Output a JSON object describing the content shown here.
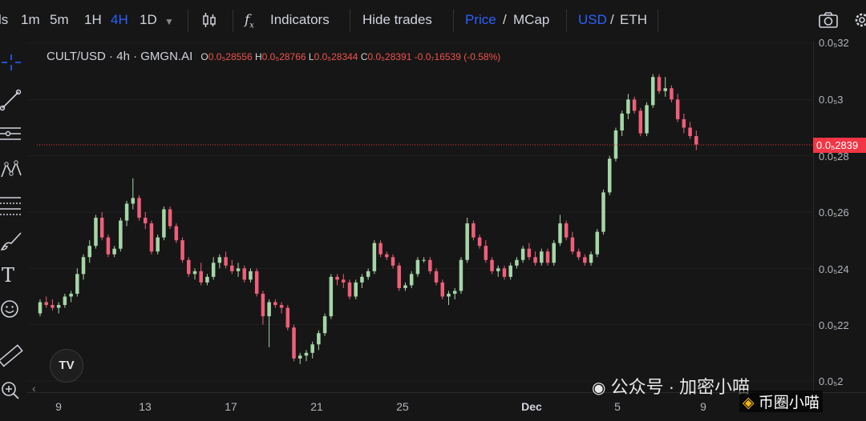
{
  "toolbar": {
    "intervals": [
      "ls",
      "1m",
      "5m",
      "1H",
      "4H",
      "1D"
    ],
    "active_interval": "4H",
    "indicators_label": "Indicators",
    "hide_trades_label": "Hide trades",
    "price_label": "Price",
    "mcap_label": "MCap",
    "usd_label": "USD",
    "eth_label": "ETH",
    "slash": "/"
  },
  "legend": {
    "symbol": "CULT/USD · 4h · GMGN.AI",
    "o_key": "O",
    "o_val": "0.0₅28556",
    "h_key": "H",
    "h_val": "0.0₅28766",
    "l_key": "L",
    "l_val": "0.0₅28344",
    "c_key": "C",
    "c_val": "0.0₅28391",
    "change": "-0.0₇16539 (-0.58%)"
  },
  "price_scale": {
    "labels": [
      "0.0₅32",
      "0.0₅3",
      "0.0₅28",
      "0.0₅26",
      "0.0₅24",
      "0.0₅22",
      "0.0₅2"
    ],
    "last_price": "0.0₅2839"
  },
  "time_scale": {
    "labels": [
      "9",
      "13",
      "17",
      "21",
      "25",
      "Dec",
      "5",
      "9"
    ]
  },
  "watermark": {
    "line1": "公众号 · 加密小喵",
    "line2": "币圈小喵"
  },
  "tv_logo_text": "TV",
  "colors": {
    "up": "#a5d6a7",
    "down": "#ef5f7a",
    "accent": "#2962ff",
    "last": "#f23645"
  },
  "chart_data": {
    "type": "candlestick",
    "x_labels": [
      "9",
      "13",
      "17",
      "21",
      "25",
      "Dec",
      "5",
      "9"
    ],
    "ylim": [
      1.98e-05,
      3.24e-05
    ],
    "last_price": 2.8391e-06,
    "candles": [
      [
        2.24,
        2.29,
        2.23,
        2.28
      ],
      [
        2.28,
        2.3,
        2.26,
        2.27
      ],
      [
        2.27,
        2.29,
        2.25,
        2.26
      ],
      [
        2.26,
        2.28,
        2.24,
        2.27
      ],
      [
        2.27,
        2.31,
        2.26,
        2.3
      ],
      [
        2.3,
        2.32,
        2.28,
        2.31
      ],
      [
        2.31,
        2.4,
        2.3,
        2.38
      ],
      [
        2.38,
        2.45,
        2.36,
        2.44
      ],
      [
        2.44,
        2.5,
        2.42,
        2.48
      ],
      [
        2.48,
        2.59,
        2.47,
        2.58
      ],
      [
        2.58,
        2.6,
        2.5,
        2.51
      ],
      [
        2.51,
        2.52,
        2.44,
        2.45
      ],
      [
        2.45,
        2.48,
        2.44,
        2.47
      ],
      [
        2.47,
        2.58,
        2.46,
        2.57
      ],
      [
        2.57,
        2.64,
        2.55,
        2.63
      ],
      [
        2.63,
        2.72,
        2.61,
        2.65
      ],
      [
        2.65,
        2.66,
        2.57,
        2.58
      ],
      [
        2.58,
        2.6,
        2.54,
        2.56
      ],
      [
        2.56,
        2.57,
        2.45,
        2.46
      ],
      [
        2.46,
        2.52,
        2.45,
        2.51
      ],
      [
        2.51,
        2.62,
        2.5,
        2.61
      ],
      [
        2.61,
        2.62,
        2.54,
        2.55
      ],
      [
        2.55,
        2.56,
        2.49,
        2.5
      ],
      [
        2.5,
        2.51,
        2.42,
        2.43
      ],
      [
        2.43,
        2.44,
        2.37,
        2.38
      ],
      [
        2.38,
        2.4,
        2.36,
        2.39
      ],
      [
        2.39,
        2.42,
        2.34,
        2.35
      ],
      [
        2.35,
        2.38,
        2.34,
        2.37
      ],
      [
        2.37,
        2.44,
        2.36,
        2.42
      ],
      [
        2.42,
        2.45,
        2.4,
        2.44
      ],
      [
        2.44,
        2.46,
        2.4,
        2.41
      ],
      [
        2.41,
        2.43,
        2.38,
        2.39
      ],
      [
        2.39,
        2.42,
        2.37,
        2.4
      ],
      [
        2.4,
        2.41,
        2.35,
        2.36
      ],
      [
        2.36,
        2.4,
        2.35,
        2.39
      ],
      [
        2.39,
        2.4,
        2.3,
        2.31
      ],
      [
        2.31,
        2.32,
        2.2,
        2.23
      ],
      [
        2.23,
        2.29,
        2.12,
        2.28
      ],
      [
        2.28,
        2.29,
        2.26,
        2.27
      ],
      [
        2.27,
        2.28,
        2.24,
        2.26
      ],
      [
        2.26,
        2.27,
        2.18,
        2.19
      ],
      [
        2.19,
        2.2,
        2.07,
        2.08
      ],
      [
        2.08,
        2.1,
        2.06,
        2.09
      ],
      [
        2.09,
        2.11,
        2.07,
        2.1
      ],
      [
        2.1,
        2.14,
        2.08,
        2.13
      ],
      [
        2.13,
        2.18,
        2.11,
        2.17
      ],
      [
        2.17,
        2.24,
        2.16,
        2.23
      ],
      [
        2.23,
        2.38,
        2.22,
        2.37
      ],
      [
        2.37,
        2.38,
        2.34,
        2.36
      ],
      [
        2.36,
        2.38,
        2.33,
        2.35
      ],
      [
        2.35,
        2.36,
        2.29,
        2.3
      ],
      [
        2.3,
        2.36,
        2.29,
        2.35
      ],
      [
        2.35,
        2.38,
        2.33,
        2.37
      ],
      [
        2.37,
        2.4,
        2.36,
        2.39
      ],
      [
        2.39,
        2.5,
        2.38,
        2.49
      ],
      [
        2.49,
        2.5,
        2.44,
        2.45
      ],
      [
        2.45,
        2.46,
        2.43,
        2.44
      ],
      [
        2.44,
        2.45,
        2.4,
        2.41
      ],
      [
        2.41,
        2.42,
        2.32,
        2.33
      ],
      [
        2.33,
        2.35,
        2.32,
        2.34
      ],
      [
        2.34,
        2.39,
        2.33,
        2.38
      ],
      [
        2.38,
        2.44,
        2.37,
        2.43
      ],
      [
        2.43,
        2.44,
        2.42,
        2.43
      ],
      [
        2.43,
        2.44,
        2.38,
        2.39
      ],
      [
        2.39,
        2.4,
        2.34,
        2.35
      ],
      [
        2.35,
        2.36,
        2.29,
        2.3
      ],
      [
        2.3,
        2.32,
        2.27,
        2.31
      ],
      [
        2.31,
        2.33,
        2.29,
        2.32
      ],
      [
        2.32,
        2.44,
        2.31,
        2.43
      ],
      [
        2.43,
        2.58,
        2.42,
        2.56
      ],
      [
        2.56,
        2.57,
        2.5,
        2.51
      ],
      [
        2.51,
        2.52,
        2.47,
        2.48
      ],
      [
        2.48,
        2.5,
        2.42,
        2.43
      ],
      [
        2.43,
        2.44,
        2.38,
        2.39
      ],
      [
        2.39,
        2.41,
        2.37,
        2.4
      ],
      [
        2.4,
        2.41,
        2.36,
        2.37
      ],
      [
        2.37,
        2.42,
        2.36,
        2.41
      ],
      [
        2.41,
        2.44,
        2.4,
        2.43
      ],
      [
        2.43,
        2.48,
        2.42,
        2.47
      ],
      [
        2.47,
        2.49,
        2.43,
        2.44
      ],
      [
        2.44,
        2.46,
        2.41,
        2.42
      ],
      [
        2.42,
        2.47,
        2.41,
        2.46
      ],
      [
        2.46,
        2.47,
        2.41,
        2.42
      ],
      [
        2.42,
        2.5,
        2.41,
        2.49
      ],
      [
        2.49,
        2.59,
        2.48,
        2.56
      ],
      [
        2.56,
        2.57,
        2.5,
        2.51
      ],
      [
        2.51,
        2.53,
        2.45,
        2.46
      ],
      [
        2.46,
        2.47,
        2.43,
        2.44
      ],
      [
        2.44,
        2.45,
        2.41,
        2.42
      ],
      [
        2.42,
        2.46,
        2.41,
        2.45
      ],
      [
        2.45,
        2.54,
        2.44,
        2.53
      ],
      [
        2.53,
        2.68,
        2.52,
        2.67
      ],
      [
        2.67,
        2.8,
        2.66,
        2.79
      ],
      [
        2.79,
        2.9,
        2.78,
        2.89
      ],
      [
        2.89,
        2.96,
        2.87,
        2.95
      ],
      [
        2.95,
        3.02,
        2.93,
        3.0
      ],
      [
        3.0,
        3.01,
        2.95,
        2.96
      ],
      [
        2.96,
        2.97,
        2.87,
        2.88
      ],
      [
        2.88,
        2.99,
        2.87,
        2.98
      ],
      [
        2.98,
        3.09,
        2.97,
        3.08
      ],
      [
        3.08,
        3.09,
        3.02,
        3.03
      ],
      [
        3.03,
        3.08,
        3.01,
        3.04
      ],
      [
        3.04,
        3.05,
        2.99,
        3.0
      ],
      [
        3.0,
        3.02,
        2.92,
        2.93
      ],
      [
        2.93,
        2.95,
        2.88,
        2.9
      ],
      [
        2.9,
        2.92,
        2.86,
        2.87
      ],
      [
        2.87,
        2.89,
        2.82,
        2.84
      ]
    ]
  }
}
